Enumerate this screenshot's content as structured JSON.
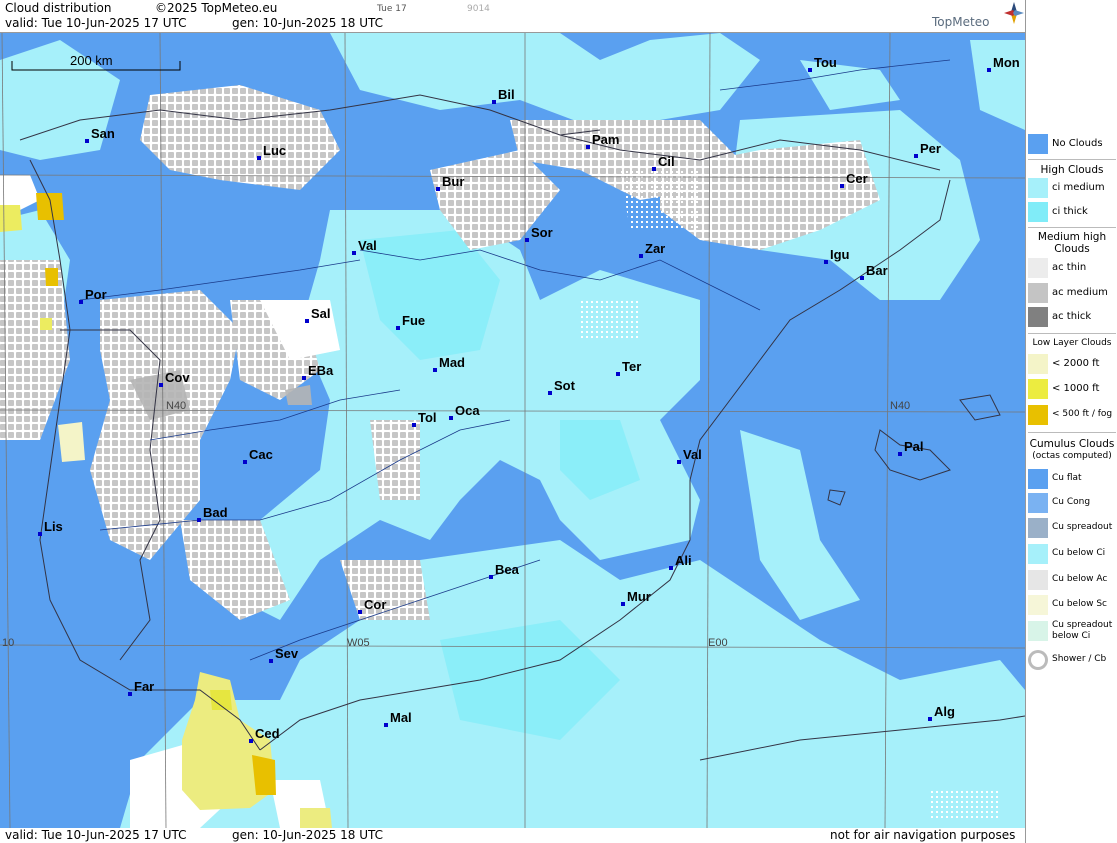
{
  "header": {
    "title": "Cloud distribution",
    "copyright": "©2025 TopMeteo.eu",
    "day_tab": "Tue 17",
    "code": "9014",
    "valid": "valid:  Tue  10-Jun-2025  17 UTC",
    "gen": "gen: 10-Jun-2025 18 UTC",
    "brand": "TopMeteo"
  },
  "footer": {
    "valid": "valid:  Tue  10-Jun-2025  17 UTC",
    "gen": "gen: 10-Jun-2025 18 UTC",
    "disclaimer": "not for air navigation purposes"
  },
  "map": {
    "scale_label": "200 km",
    "grid_labels": {
      "n40_west": "N40",
      "n40_east": "N40",
      "w05": "W05",
      "e00": "E00",
      "w10": "10"
    },
    "cities": [
      {
        "name": "San"
      },
      {
        "name": "Luc"
      },
      {
        "name": "Bil"
      },
      {
        "name": "Pam"
      },
      {
        "name": "Tou"
      },
      {
        "name": "Mon"
      },
      {
        "name": "Cil"
      },
      {
        "name": "Bur"
      },
      {
        "name": "Per"
      },
      {
        "name": "Cer"
      },
      {
        "name": "Sor"
      },
      {
        "name": "Val"
      },
      {
        "name": "Zar"
      },
      {
        "name": "Igu"
      },
      {
        "name": "Bar"
      },
      {
        "name": "Por"
      },
      {
        "name": "Sal"
      },
      {
        "name": "Fue"
      },
      {
        "name": "Mad"
      },
      {
        "name": "Cov"
      },
      {
        "name": "EBa"
      },
      {
        "name": "Ter"
      },
      {
        "name": "Sot"
      },
      {
        "name": "Tol"
      },
      {
        "name": "Oca"
      },
      {
        "name": "Cac"
      },
      {
        "name": "Val"
      },
      {
        "name": "Pal"
      },
      {
        "name": "Bad"
      },
      {
        "name": "Lis"
      },
      {
        "name": "Ali"
      },
      {
        "name": "Bea"
      },
      {
        "name": "Mur"
      },
      {
        "name": "Cor"
      },
      {
        "name": "Sev"
      },
      {
        "name": "Far"
      },
      {
        "name": "Mal"
      },
      {
        "name": "Alg"
      },
      {
        "name": "Ced"
      }
    ],
    "colors": {
      "no_clouds": "#5aa0f0",
      "ci_medium": "#a6f0fa",
      "ci_thick": "#80ecf8",
      "ac_medium": "#c4c4c4",
      "low": "#ecec80",
      "fog": "#e8c000",
      "cu_flat_dots": "#ffffff"
    }
  },
  "legend": {
    "no_clouds": "No Clouds",
    "high_head": "High Clouds",
    "ci_medium": "ci medium",
    "ci_thick": "ci thick",
    "medium_head": "Medium high Clouds",
    "ac_thin": "ac thin",
    "ac_medium": "ac medium",
    "ac_thick": "ac thick",
    "low_head": "Low Layer Clouds",
    "low_2000": "< 2000 ft",
    "low_1000": "< 1000 ft",
    "low_500": "< 500 ft / fog",
    "cu_head": "Cumulus Clouds",
    "cu_sub": "(octas computed)",
    "cu_flat": "Cu flat",
    "cu_cong": "Cu Cong",
    "cu_spreadout": "Cu spreadout",
    "cu_below_ci": "Cu below Ci",
    "cu_below_ac": "Cu below Ac",
    "cu_below_sc": "Cu below Sc",
    "cu_spreadout_below_ci": "Cu spreadout below Ci",
    "shower": "Shower / Cb"
  }
}
